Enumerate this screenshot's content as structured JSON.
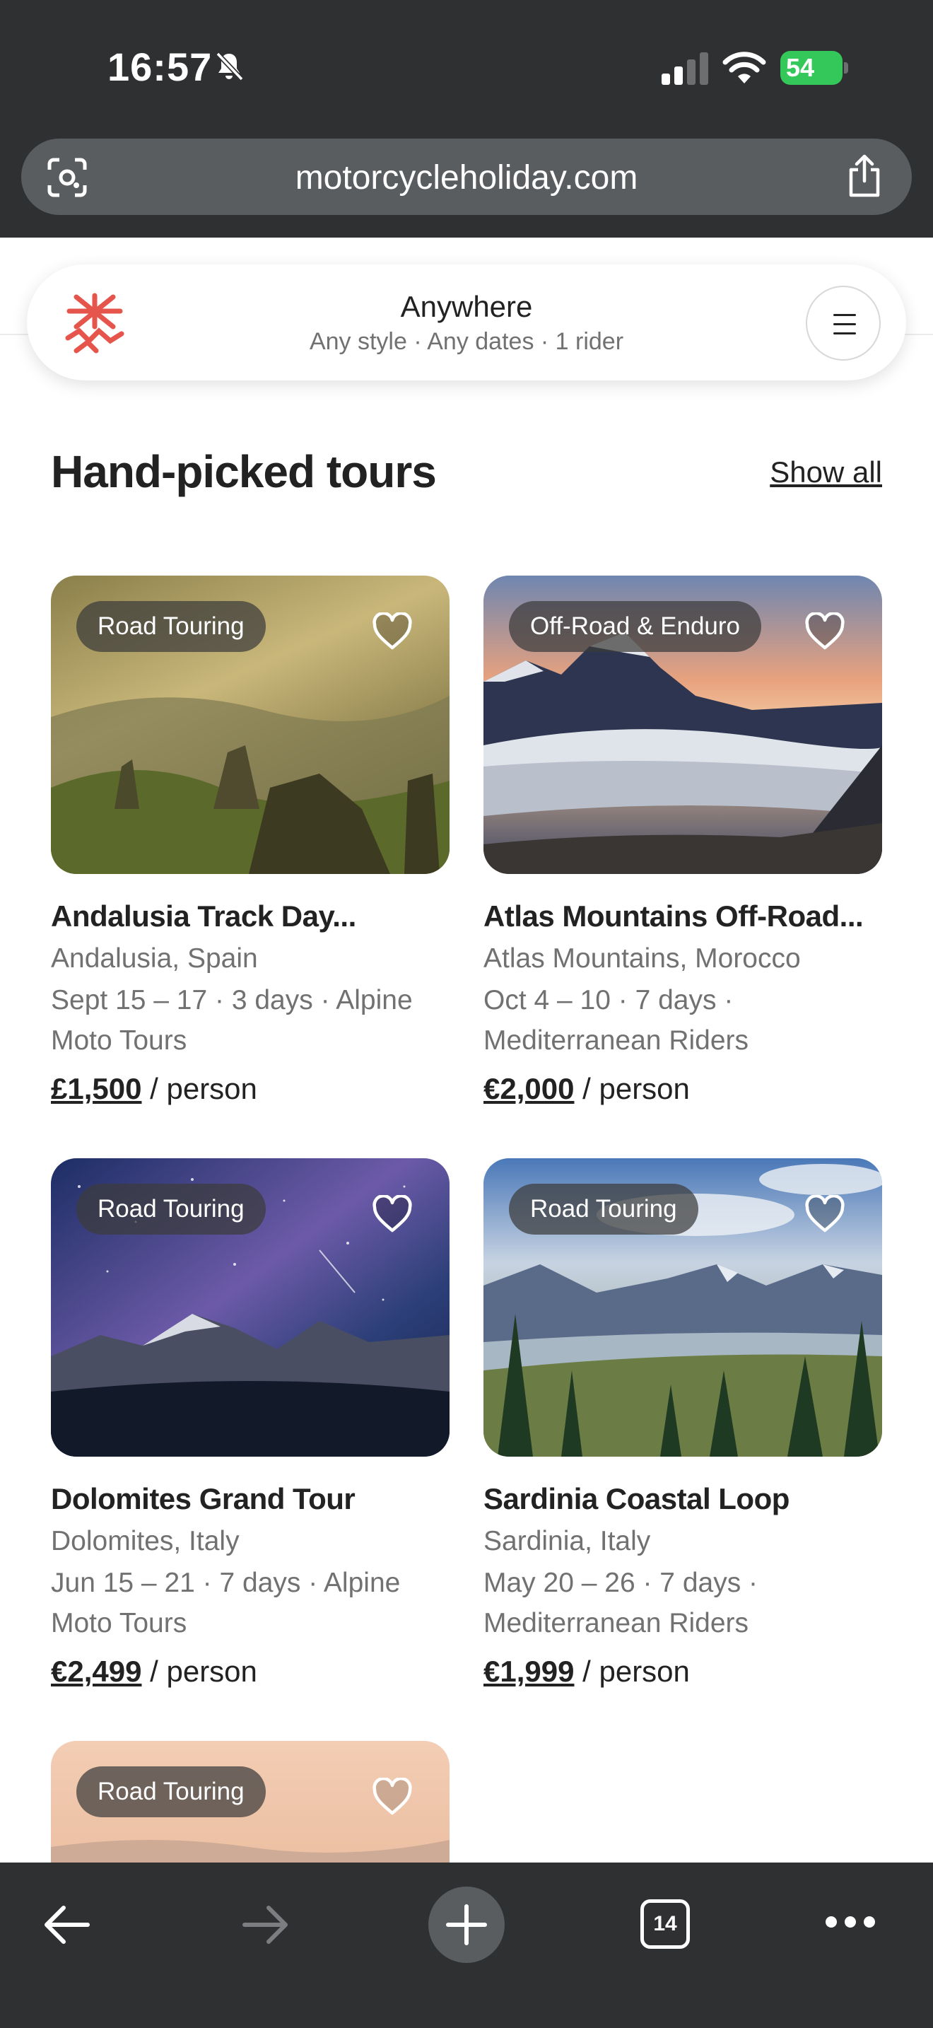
{
  "status_bar": {
    "time": "16:57",
    "battery": "54"
  },
  "browser": {
    "url": "motorcycleholiday.com",
    "tab_count": "14"
  },
  "search": {
    "title": "Anywhere",
    "subtitle": "Any style · Any dates · 1 rider"
  },
  "section": {
    "title": "Hand-picked tours",
    "show_all": "Show all"
  },
  "tours": [
    {
      "badge": "Road Touring",
      "title": "Andalusia Track Day...",
      "location": "Andalusia, Spain",
      "meta": "Sept 15 – 17 · 3 days · Alpine Moto Tours",
      "price": "£1,500",
      "per": "/ person"
    },
    {
      "badge": "Off-Road & Enduro",
      "title": "Atlas Mountains Off-Road...",
      "location": "Atlas Mountains, Morocco",
      "meta": "Oct 4 – 10 · 7 days · Mediterranean Riders",
      "price": "€2,000",
      "per": "/ person"
    },
    {
      "badge": "Road Touring",
      "title": "Dolomites Grand Tour",
      "location": "Dolomites, Italy",
      "meta": "Jun 15 – 21 · 7 days · Alpine Moto Tours",
      "price": "€2,499",
      "per": "/ person"
    },
    {
      "badge": "Road Touring",
      "title": "Sardinia Coastal Loop",
      "location": "Sardinia, Italy",
      "meta": "May 20 – 26 · 7 days · Mediterranean Riders",
      "price": "€1,999",
      "per": "/ person"
    },
    {
      "badge": "Road Touring"
    }
  ],
  "colors": {
    "brand": "#e5554b",
    "chrome": "#2f3032",
    "battery": "#34c759"
  }
}
